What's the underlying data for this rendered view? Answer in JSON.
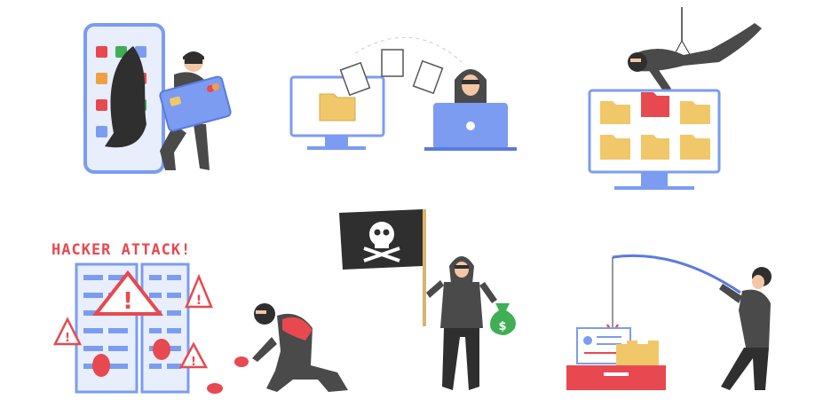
{
  "illustration": {
    "headline": "HACKER ATTACK!",
    "money_symbol": "$",
    "colors": {
      "accent_red": "#e8484f",
      "device_blue": "#7b9cf0",
      "device_blue_dark": "#5a7ae0",
      "hacker_gray": "#4a4a4a",
      "hacker_dark": "#2f2f2f",
      "folder_yellow": "#f0c86a",
      "money_green": "#3fae54",
      "phone_screen": "#e8eefc"
    },
    "scenes": [
      {
        "id": "phone-card-theft",
        "icon": "smartphone-icon"
      },
      {
        "id": "file-transfer",
        "icon": "laptop-icon"
      },
      {
        "id": "hanging-folder-theft",
        "icon": "monitor-icon"
      },
      {
        "id": "hacker-attack-servers",
        "icon": "server-icon"
      },
      {
        "id": "pirate-flag-money",
        "icon": "pirate-flag-icon"
      },
      {
        "id": "phishing-fishing",
        "icon": "fishing-rod-icon"
      }
    ]
  }
}
